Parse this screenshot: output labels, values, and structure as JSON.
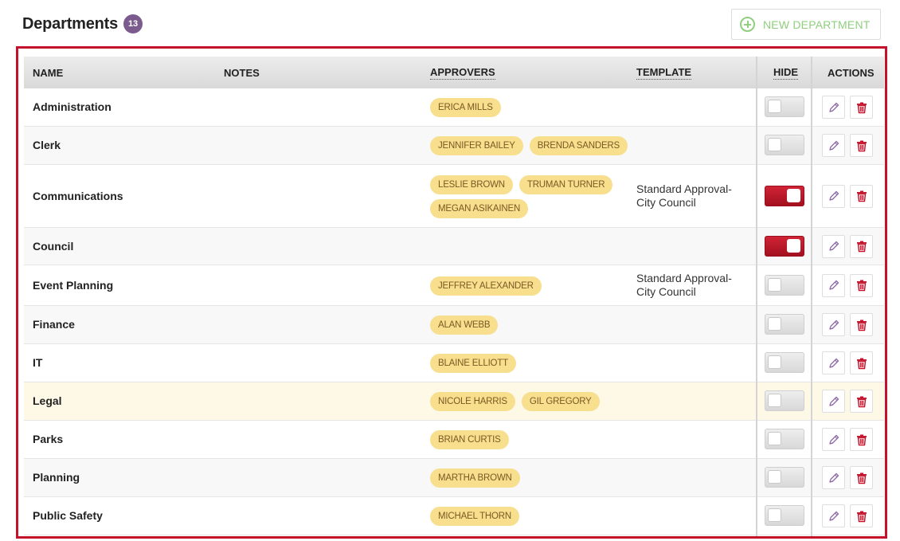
{
  "header": {
    "title": "Departments",
    "count": "13"
  },
  "new_button": {
    "label": "NEW DEPARTMENT",
    "icon": "plus-circle-icon"
  },
  "colors": {
    "accent_red": "#c3122a",
    "badge_purple": "#7b5a8e",
    "pill_yellow": "#f7df8e",
    "add_green": "#8fcf7d",
    "edit_purple": "#8e6aa6"
  },
  "columns": {
    "name": "NAME",
    "notes": "NOTES",
    "approvers": "APPROVERS",
    "template": "TEMPLATE",
    "hide": "HIDE",
    "actions": "ACTIONS"
  },
  "rows": [
    {
      "name": "Administration",
      "approvers": [
        "ERICA MILLS"
      ],
      "template": "",
      "hidden": false
    },
    {
      "name": "Clerk",
      "approvers": [
        "JENNIFER BAILEY",
        "BRENDA SANDERS"
      ],
      "template": "",
      "hidden": false
    },
    {
      "name": "Communications",
      "approvers": [
        "LESLIE BROWN",
        "TRUMAN TURNER",
        "MEGAN ASIKAINEN"
      ],
      "template": "Standard Approval- City Council",
      "hidden": true
    },
    {
      "name": "Council",
      "approvers": [],
      "template": "",
      "hidden": true
    },
    {
      "name": "Event Planning",
      "approvers": [
        "JEFFREY ALEXANDER"
      ],
      "template": "Standard Approval- City Council",
      "hidden": false
    },
    {
      "name": "Finance",
      "approvers": [
        "ALAN WEBB"
      ],
      "template": "",
      "hidden": false
    },
    {
      "name": "IT",
      "approvers": [
        "BLAINE ELLIOTT"
      ],
      "template": "",
      "hidden": false
    },
    {
      "name": "Legal",
      "approvers": [
        "NICOLE HARRIS",
        "GIL GREGORY"
      ],
      "template": "",
      "hidden": false
    },
    {
      "name": "Parks",
      "approvers": [
        "BRIAN CURTIS"
      ],
      "template": "",
      "hidden": false
    },
    {
      "name": "Planning",
      "approvers": [
        "MARTHA BROWN"
      ],
      "template": "",
      "hidden": false
    },
    {
      "name": "Public Safety",
      "approvers": [
        "MICHAEL THORN"
      ],
      "template": "",
      "hidden": false
    }
  ]
}
